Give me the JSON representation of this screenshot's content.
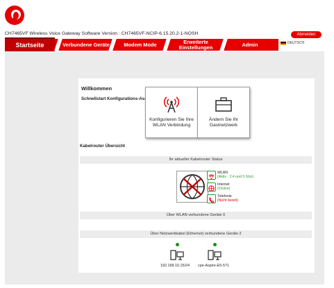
{
  "header": {
    "device_info": "CH7465VF   Wireless Voice Gateway   Software Version : CH7465VF-NCIP-6.15.20.2-1-NOSH",
    "logout_label": "Abmelden",
    "language": "DEUTSCH"
  },
  "nav": {
    "tabs": [
      {
        "label": "Startseite",
        "active": true
      },
      {
        "label": "Verbundene Geräte"
      },
      {
        "label": "Modem Mode"
      },
      {
        "label": "Erweiterte Einstellungen"
      },
      {
        "label": "Admin"
      }
    ]
  },
  "main": {
    "welcome": "Willkommen",
    "wizard_title": "Schnellstart Konfigurations-Assistent",
    "cards": [
      {
        "label": "Konfigurieren Sie Ihre WLAN Verbindung",
        "icon": "wifi-antenna-icon"
      },
      {
        "label": "Ändern Sie Ihr Gastnetzwerk",
        "icon": "briefcase-icon"
      }
    ],
    "overview_title": "Kabelrouter Übersicht",
    "status_header": "Ihr aktueller Kabelrouter Status",
    "status": [
      {
        "name": "WLAN",
        "detail": "(Aktiv - 2.4 und 5 Ghz)",
        "color": "#2e9a2e",
        "icon": "wifi-icon"
      },
      {
        "name": "Internet",
        "detail": "(Online)",
        "color": "#2e9a2e",
        "icon": "globe-icon"
      },
      {
        "name": "Telefonie",
        "detail": "(Nicht bereit)",
        "color": "#e00000",
        "icon": "phone-icon"
      }
    ],
    "wlan_devices_header": "Über WLAN verbundene Geräte 0",
    "ethernet_devices_header": "Über Netzwerkkabel (Ethernet) verbundene Geräte 2",
    "ethernet_devices": [
      {
        "label": "192.168.10.15/24"
      },
      {
        "label": "cpe-Aspire-E5-571"
      }
    ]
  },
  "colors": {
    "brand": "#e60000",
    "online": "#2e9a2e",
    "error": "#e00000"
  }
}
